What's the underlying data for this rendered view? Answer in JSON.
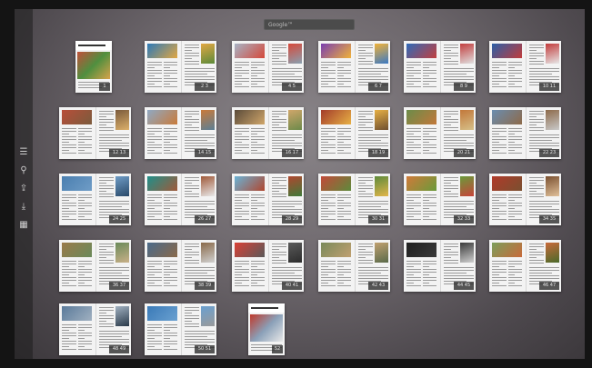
{
  "search": {
    "placeholder": "Google™"
  },
  "sidebar": {
    "icons": [
      "list-icon",
      "search-icon",
      "share-icon",
      "download-icon",
      "grid-icon"
    ]
  },
  "pages": [
    {
      "label": "1",
      "single": true,
      "colors": [
        "#c0503a",
        "#4f8f3f",
        "#d8a24a"
      ]
    },
    {
      "label": "2 3",
      "colors": [
        "#2c79b8",
        "#e1a743",
        "#5b8a3a"
      ]
    },
    {
      "label": "4 5",
      "colors": [
        "#a7b3c5",
        "#d5493a",
        "#8aa0b0"
      ]
    },
    {
      "label": "6 7",
      "colors": [
        "#7a3fb0",
        "#f0b23a",
        "#3c7ac4"
      ]
    },
    {
      "label": "8 9",
      "colors": [
        "#2f6ab8",
        "#c23f3f",
        "#e0e0e0"
      ]
    },
    {
      "label": "10 11",
      "colors": [
        "#2b5fa8",
        "#c13b3b",
        "#e7e7e7"
      ]
    },
    {
      "label": "12 13",
      "colors": [
        "#b84e3a",
        "#7b5b3c",
        "#dcb06a"
      ]
    },
    {
      "label": "14 15",
      "colors": [
        "#8fa9c4",
        "#c97a3a",
        "#5c7f95"
      ]
    },
    {
      "label": "16 17",
      "colors": [
        "#5a4b3a",
        "#d0a66a",
        "#6c8a4a"
      ]
    },
    {
      "label": "18 19",
      "colors": [
        "#a33b2b",
        "#e7b044",
        "#6f4f2f"
      ]
    },
    {
      "label": "20 21",
      "colors": [
        "#6b8c4a",
        "#c2783a",
        "#d6c089"
      ]
    },
    {
      "label": "22 23",
      "colors": [
        "#6a8db0",
        "#8d6a4a",
        "#c9c9c9"
      ]
    },
    {
      "label": "24 25",
      "colors": [
        "#4a7fb0",
        "#6f9cc6",
        "#2a4a6a"
      ]
    },
    {
      "label": "26 27",
      "colors": [
        "#1f8f8a",
        "#a05a3a",
        "#e8e8e8"
      ]
    },
    {
      "label": "28 29",
      "colors": [
        "#6ab3d6",
        "#b0472f",
        "#3f7a3a"
      ]
    },
    {
      "label": "30 31",
      "colors": [
        "#c24a3a",
        "#5e8a3b",
        "#e2b64a"
      ]
    },
    {
      "label": "32 33",
      "colors": [
        "#d07a3a",
        "#6a9a3a",
        "#c8443a"
      ]
    },
    {
      "label": "34 35",
      "colors": [
        "#b03a2a",
        "#7a5030",
        "#e0c09a"
      ]
    },
    {
      "label": "36 37",
      "colors": [
        "#9a7a4a",
        "#6a8a5a",
        "#c9b088"
      ]
    },
    {
      "label": "38 39",
      "colors": [
        "#4a6a8a",
        "#8a6a4a",
        "#d0d0d0"
      ]
    },
    {
      "label": "40 41",
      "colors": [
        "#d94035",
        "#5a5a5a",
        "#2c2c2c"
      ]
    },
    {
      "label": "42 43",
      "colors": [
        "#7a8a5a",
        "#c0a070",
        "#5a6a4a"
      ]
    },
    {
      "label": "44 45",
      "colors": [
        "#202020",
        "#3a3a3a",
        "#d0d0d0"
      ]
    },
    {
      "label": "46 47",
      "colors": [
        "#7c9e5a",
        "#c86a3a",
        "#4a6a2a"
      ]
    },
    {
      "label": "48 49",
      "colors": [
        "#5a7a9a",
        "#a0b0c0",
        "#2a3a4a"
      ]
    },
    {
      "label": "50 51",
      "colors": [
        "#3a7ab8",
        "#6aa0d0",
        "#9a9a9a"
      ]
    },
    {
      "label": "52",
      "single": true,
      "colors": [
        "#c0392b",
        "#8aa0b8",
        "#e8e8e8"
      ]
    }
  ]
}
